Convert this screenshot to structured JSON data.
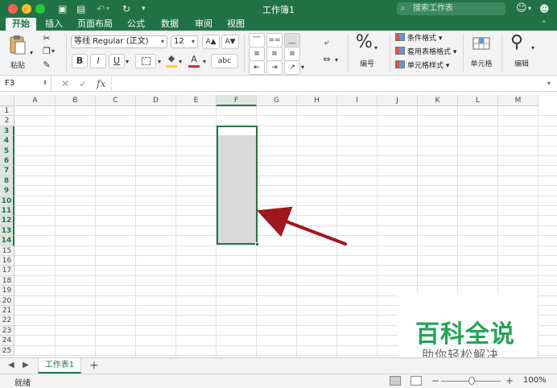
{
  "window": {
    "title": "工作簿1"
  },
  "search": {
    "placeholder": "搜索工作表"
  },
  "tabs": [
    "开始",
    "插入",
    "页面布局",
    "公式",
    "数据",
    "审阅",
    "视图"
  ],
  "ribbon": {
    "paste_label": "粘贴",
    "font_name": "等线 Regular (正文)",
    "font_size": "12",
    "grow_font": "A▲",
    "shrink_font": "A▼",
    "bold": "B",
    "italic": "I",
    "underline": "U",
    "font_color_letter": "A",
    "number_format_label": "编号",
    "percent_symbol": "%",
    "conditional_format": "条件格式",
    "format_as_table": "套用表格格式",
    "cell_styles": "单元格样式",
    "cells_label": "单元格",
    "editing_label": "编辑"
  },
  "formula_bar": {
    "name_box": "F3",
    "fx": "fx",
    "value": ""
  },
  "columns": [
    "A",
    "B",
    "C",
    "D",
    "E",
    "F",
    "G",
    "H",
    "I",
    "J",
    "K",
    "L",
    "M"
  ],
  "rows": [
    "1",
    "2",
    "3",
    "4",
    "5",
    "6",
    "7",
    "8",
    "9",
    "10",
    "11",
    "12",
    "13",
    "14",
    "15",
    "16",
    "17",
    "18",
    "19",
    "20",
    "21",
    "22",
    "23",
    "24",
    "25"
  ],
  "selection": {
    "name": "F3:F14",
    "column": "F",
    "first_row": 3,
    "last_row": 14
  },
  "watermark": {
    "big": "百科全说",
    "small": "助你轻松解决"
  },
  "sheets": {
    "active": "工作表1",
    "add": "+"
  },
  "status": {
    "text": "就绪",
    "zoom": "100%"
  },
  "colors": {
    "accent": "#217346",
    "arrow": "#a0171c",
    "watermark": "#23a455"
  }
}
